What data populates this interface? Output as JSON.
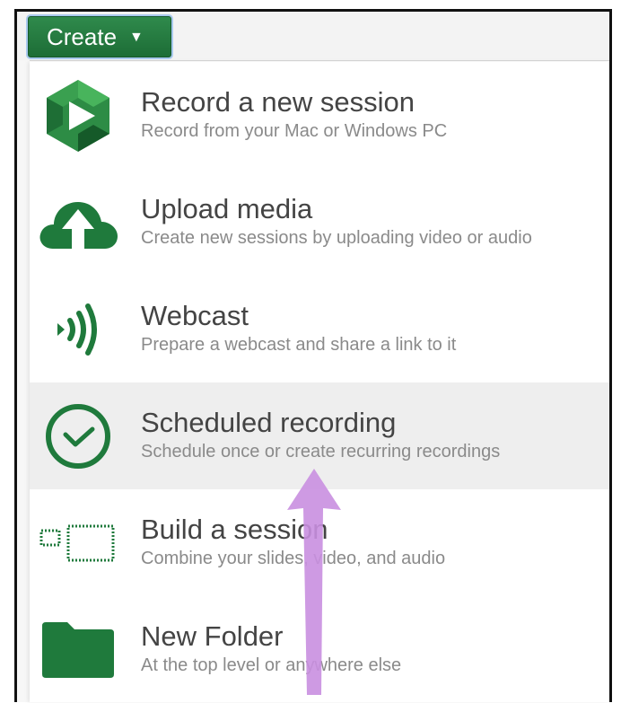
{
  "toolbar": {
    "create_label": "Create",
    "caret": "▼"
  },
  "menu": {
    "items": [
      {
        "title": "Record a new session",
        "subtitle": "Record from your Mac or Windows PC",
        "icon": "panopto-play-icon"
      },
      {
        "title": "Upload media",
        "subtitle": "Create new sessions by uploading video or audio",
        "icon": "cloud-upload-icon"
      },
      {
        "title": "Webcast",
        "subtitle": "Prepare a webcast and share a link to it",
        "icon": "broadcast-icon"
      },
      {
        "title": "Scheduled recording",
        "subtitle": "Schedule once or create recurring recordings",
        "icon": "clock-icon"
      },
      {
        "title": "Build a session",
        "subtitle": "Combine your slides, video, and audio",
        "icon": "build-session-icon"
      },
      {
        "title": "New Folder",
        "subtitle": "At the top level or anywhere else",
        "icon": "folder-icon"
      }
    ],
    "highlighted_index": 3
  },
  "colors": {
    "brand_green": "#1f7a3c",
    "create_button": "#267f43",
    "highlight": "#eeeeee",
    "annotation_arrow": "#c98fe0"
  }
}
